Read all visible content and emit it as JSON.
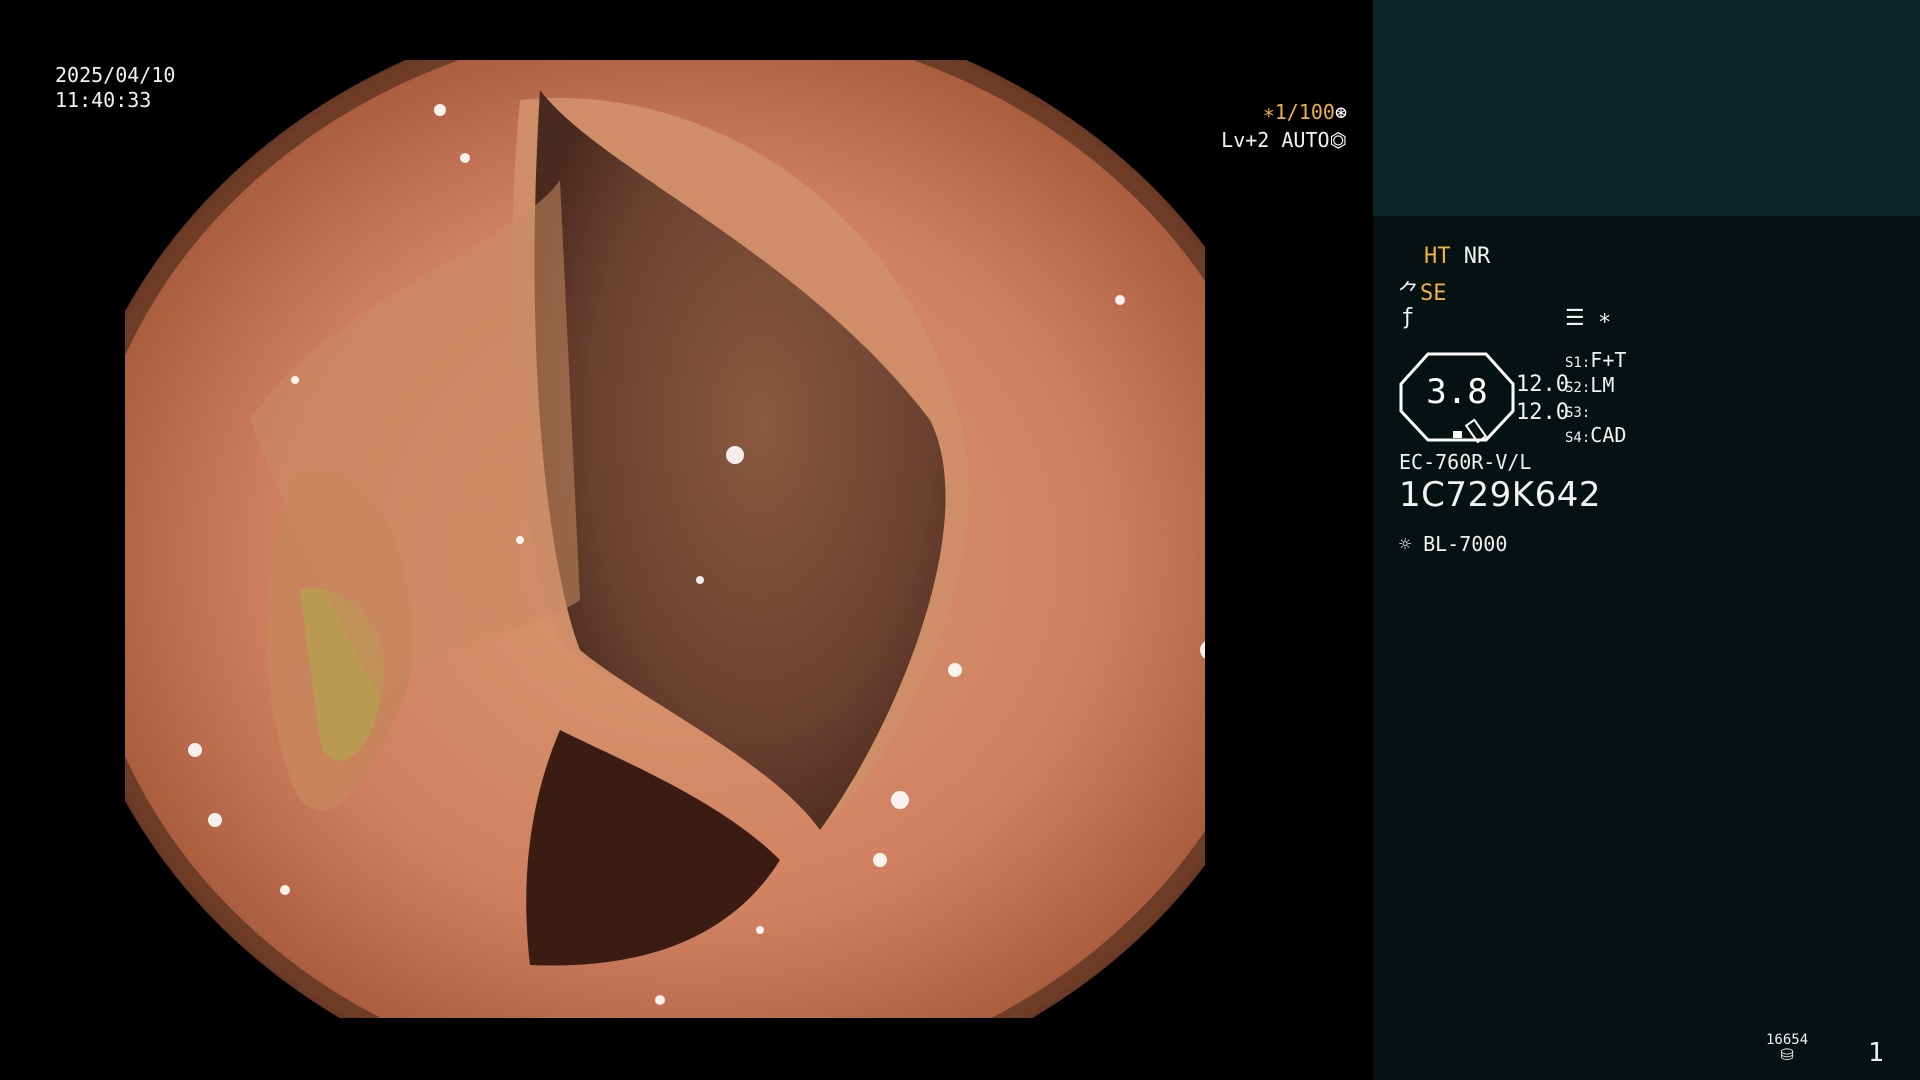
{
  "overlay": {
    "date": "2025/04/10",
    "time": "11:40:33",
    "shutter": "∗1/100",
    "shutter_icon": "aperture-icon",
    "iris_level": "Lv+2 AUTO",
    "iris_icon": "iris-icon"
  },
  "panel": {
    "ht_label": "HT",
    "nr_label": "NR",
    "se_label": "SE",
    "scope_icon": "scope-bend-icon",
    "hook_icon": "hook-icon",
    "menu_icon": "list-menu-icon",
    "star": "∗",
    "gauge_value": "3.8",
    "gauge_val1": "12.0",
    "gauge_val2": "12.0",
    "s1_label": "S1:",
    "s1_value": "F+T",
    "s2_label": "S2:",
    "s2_value": "LM",
    "s3_label": "S3:",
    "s3_value": "",
    "s4_label": "S4:",
    "s4_value": "CAD",
    "scope_model": "EC-760R-V/L",
    "scope_serial": "1C729K642",
    "light_icon": "sun-icon",
    "light_source": "BL-7000",
    "storage_count": "16654",
    "storage_icon": "disk-icon",
    "page_number": "1"
  },
  "colors": {
    "accent": "#f0b040",
    "panel_bg": "#061212",
    "panel_top_bg": "#0c2828"
  }
}
